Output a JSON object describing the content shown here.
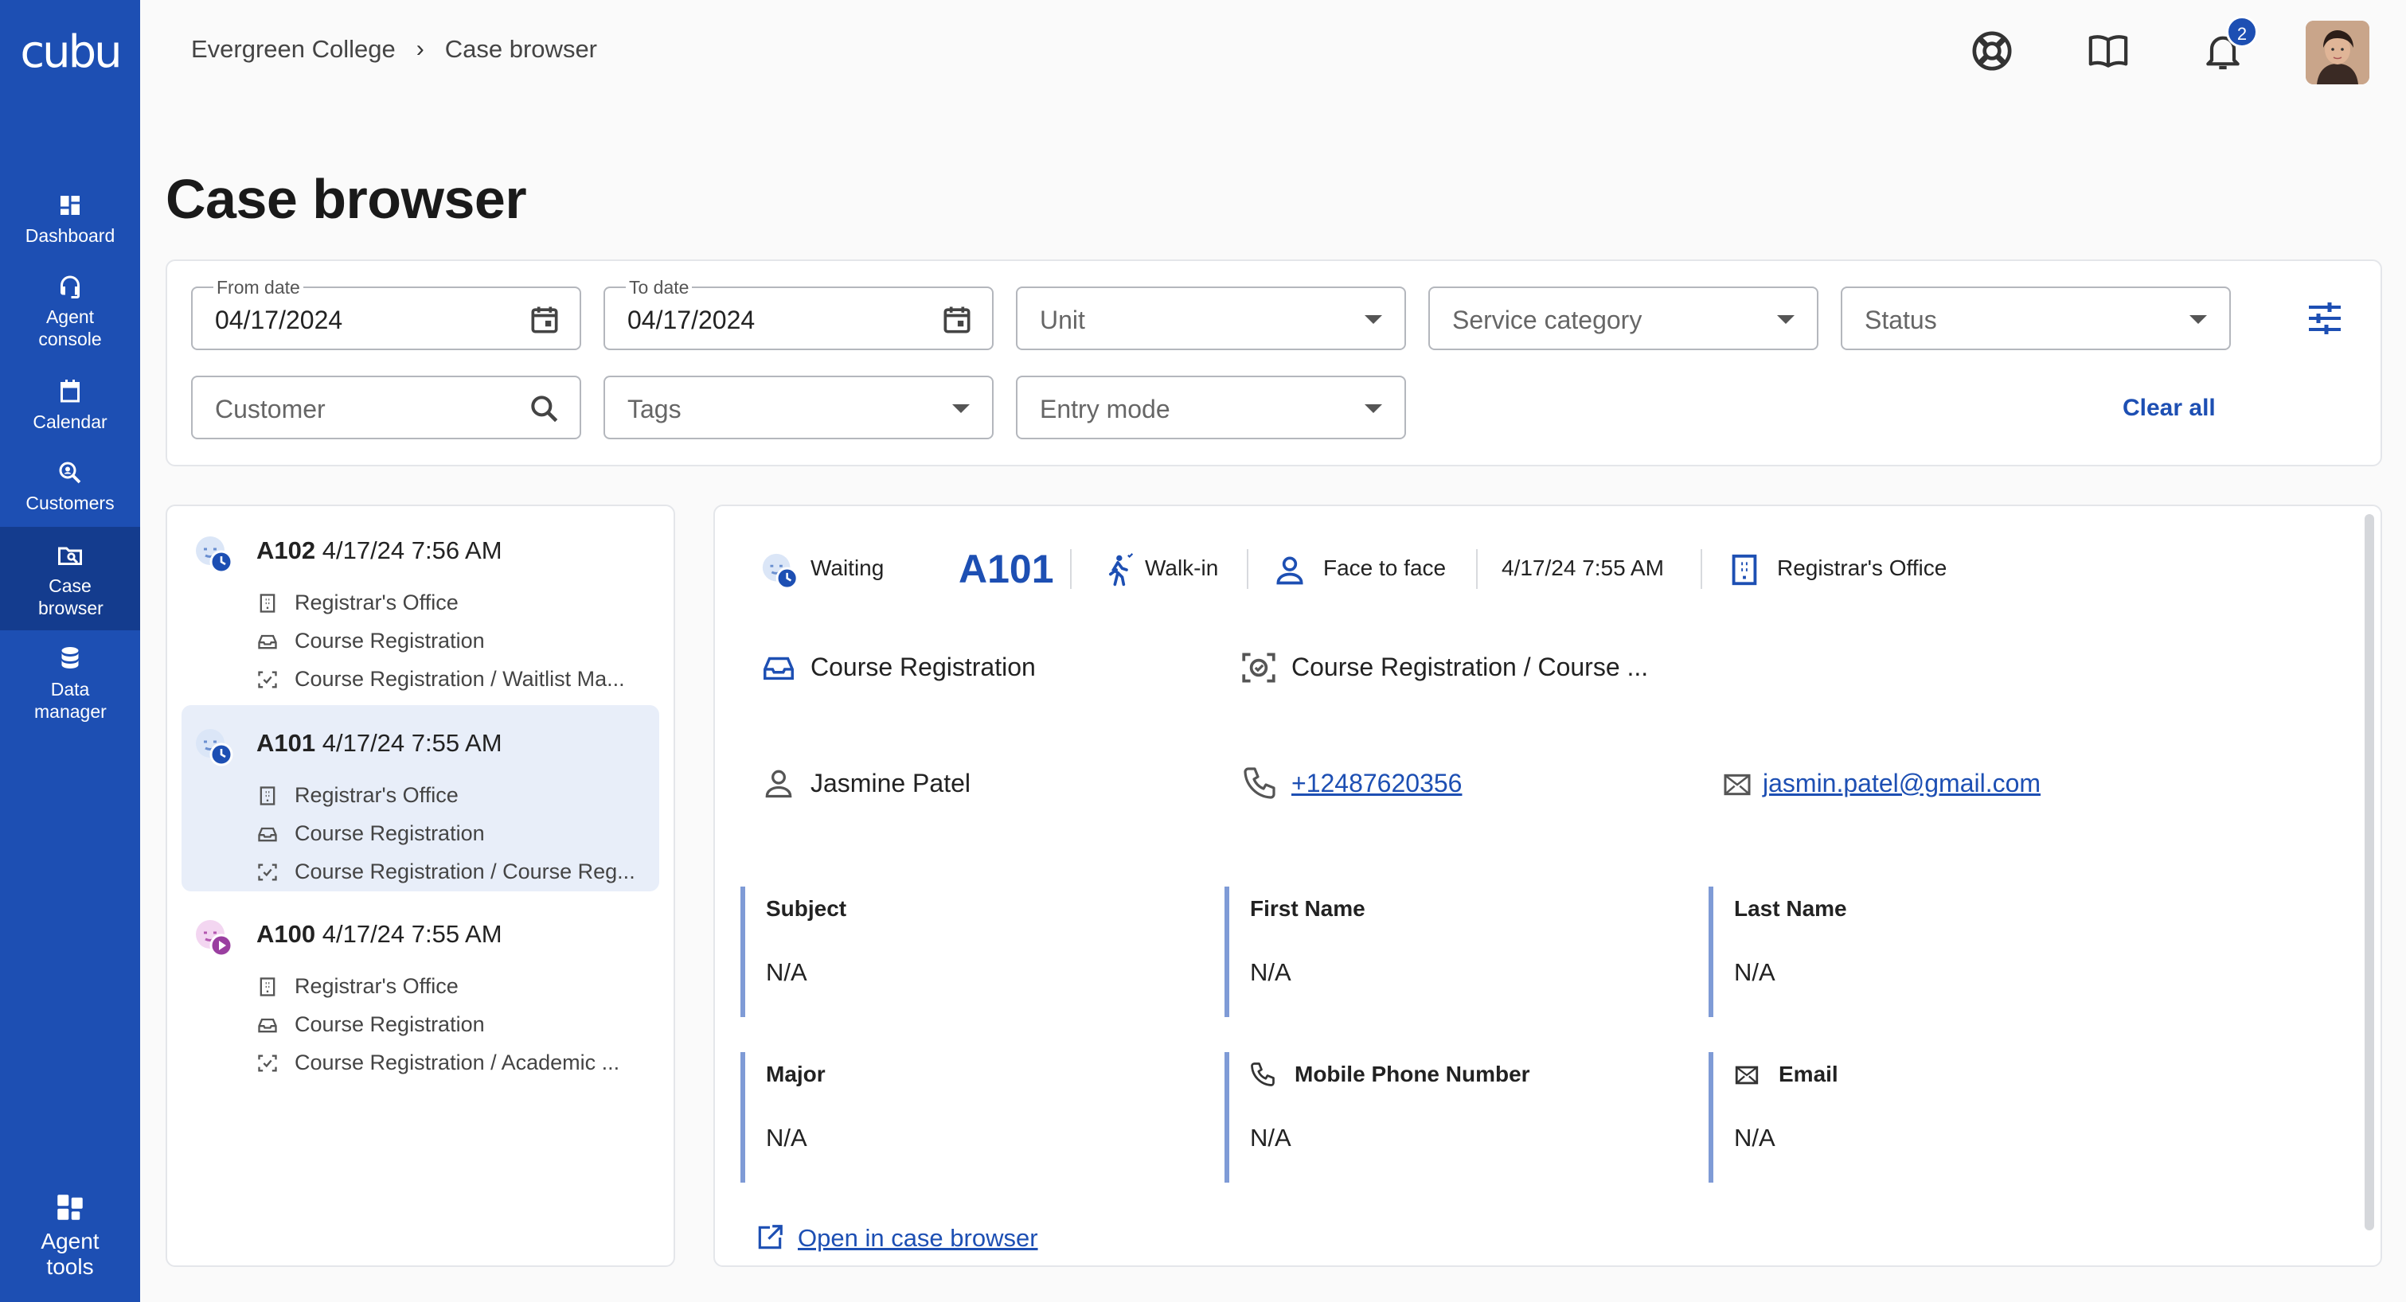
{
  "app": {
    "logo": "cubu"
  },
  "sidebar": {
    "items": [
      {
        "label": "Dashboard",
        "icon": "dashboard-icon"
      },
      {
        "label": "Agent console",
        "icon": "headset-icon"
      },
      {
        "label": "Calendar",
        "icon": "calendar-icon"
      },
      {
        "label": "Customers",
        "icon": "customer-search-icon"
      },
      {
        "label": "Case browser",
        "icon": "case-browser-icon",
        "active": true
      },
      {
        "label": "Data manager",
        "icon": "database-icon"
      }
    ],
    "footer": {
      "label": "Agent tools",
      "icon": "grid-tools-icon"
    }
  },
  "topbar": {
    "breadcrumb": [
      "Evergreen College",
      "Case browser"
    ],
    "notifications_count": "2"
  },
  "page": {
    "title": "Case browser"
  },
  "filters": {
    "from_date": {
      "label": "From date",
      "value": "04/17/2024"
    },
    "to_date": {
      "label": "To date",
      "value": "04/17/2024"
    },
    "unit": "Unit",
    "service_category": "Service category",
    "status": "Status",
    "customer": "Customer",
    "tags": "Tags",
    "entry_mode": "Entry mode",
    "clear_all": "Clear all"
  },
  "cases": [
    {
      "id": "A102",
      "datetime": "4/17/24 7:56 AM",
      "office": "Registrar's Office",
      "category": "Course Registration",
      "service": "Course Registration / Waitlist Ma...",
      "status_icon": "waiting-icon"
    },
    {
      "id": "A101",
      "datetime": "4/17/24 7:55 AM",
      "office": "Registrar's Office",
      "category": "Course Registration",
      "service": "Course Registration / Course Reg...",
      "status_icon": "waiting-icon",
      "selected": true
    },
    {
      "id": "A100",
      "datetime": "4/17/24 7:55 AM",
      "office": "Registrar's Office",
      "category": "Course Registration",
      "service": "Course Registration / Academic ...",
      "status_icon": "serving-icon"
    }
  ],
  "detail": {
    "status": "Waiting",
    "ticket": "A101",
    "entry": "Walk-in",
    "mode": "Face to face",
    "datetime": "4/17/24 7:55 AM",
    "office": "Registrar's Office",
    "category": "Course Registration",
    "service": "Course Registration / Course ...",
    "customer_name": "Jasmine Patel",
    "phone": "+12487620356",
    "email": "jasmin.patel@gmail.com",
    "fields": [
      {
        "label": "Subject",
        "value": "N/A"
      },
      {
        "label": "First Name",
        "value": "N/A"
      },
      {
        "label": "Last Name",
        "value": "N/A"
      },
      {
        "label": "Major",
        "value": "N/A"
      },
      {
        "label": "Mobile Phone Number",
        "value": "N/A"
      },
      {
        "label": "Email",
        "value": "N/A"
      }
    ],
    "open_link": "Open in case browser"
  },
  "colors": {
    "primary": "#1d4fb3",
    "sidebar_active": "#143c8e",
    "selected_row": "#e8eef9",
    "field_accent": "#7f9bd6"
  }
}
